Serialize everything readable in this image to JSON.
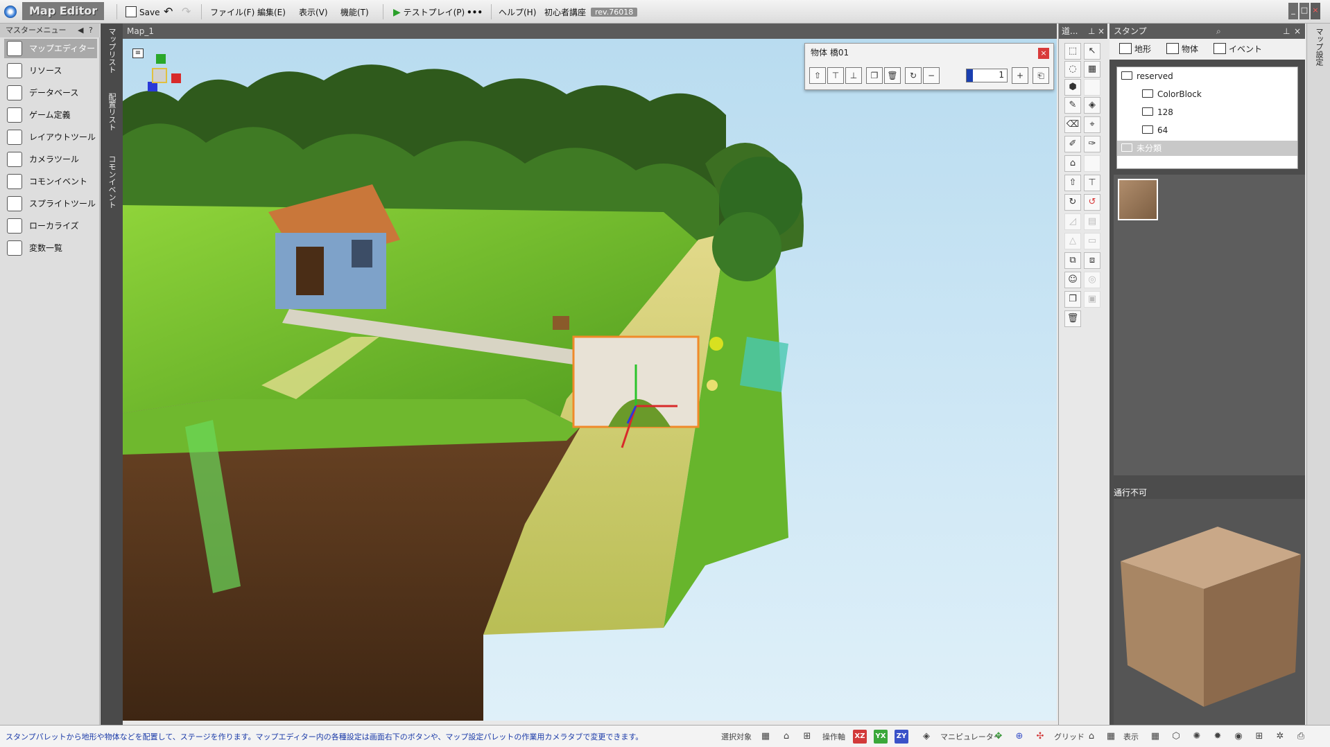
{
  "titlebar": {
    "app_title": "Map Editor",
    "save_label": "Save",
    "menus": [
      "ファイル(F)",
      "編集(E)",
      "表示(V)",
      "機能(T)"
    ],
    "testplay_label": "テストプレイ(P)",
    "more_label": "•••",
    "help_label": "ヘルプ(H)",
    "tutorial_label": "初心者講座",
    "revision": "rev.76018"
  },
  "left_menu": {
    "header": "マスターメニュー",
    "items": [
      {
        "label": "マップエディター",
        "icon": "map-editor-icon",
        "active": true
      },
      {
        "label": "リソース",
        "icon": "resource-icon"
      },
      {
        "label": "データベース",
        "icon": "database-icon"
      },
      {
        "label": "ゲーム定義",
        "icon": "game-definition-icon"
      },
      {
        "label": "レイアウトツール",
        "icon": "layout-tool-icon"
      },
      {
        "label": "カメラツール",
        "icon": "camera-tool-icon"
      },
      {
        "label": "コモンイベント",
        "icon": "common-event-icon"
      },
      {
        "label": "スプライトツール",
        "icon": "sprite-tool-icon"
      },
      {
        "label": "ローカライズ",
        "icon": "localize-icon"
      },
      {
        "label": "変数一覧",
        "icon": "variables-icon"
      }
    ]
  },
  "vertical_tabs": [
    "マップリスト",
    "配置リスト",
    "コモンイベント"
  ],
  "viewport": {
    "tab_title": "Map_1"
  },
  "object_panel": {
    "title": "物体 橋01",
    "close": "×",
    "value": "1",
    "level": 0.15
  },
  "tool_palette": {
    "header": "道..."
  },
  "stamp_panel": {
    "header": "スタンプ",
    "tabs": [
      "地形",
      "物体",
      "イベント"
    ],
    "tree": [
      {
        "label": "reserved",
        "level": 0
      },
      {
        "label": "ColorBlock",
        "level": 1
      },
      {
        "label": "128",
        "level": 1
      },
      {
        "label": "64",
        "level": 1
      },
      {
        "label": "未分類",
        "level": 0,
        "selected": true
      }
    ],
    "preview_label": "通行不可"
  },
  "right_strip_label": "マップ設定",
  "statusbar": {
    "message": "スタンプパレットから地形や物体などを配置して、ステージを作ります。マップエディター内の各種設定は画面右下のボタンや、マップ設定パレットの作業用カメラタブで変更できます。",
    "select_target_label": "選択対象",
    "operation_axis_label": "操作軸",
    "axis_buttons": [
      "XZ",
      "YX",
      "ZY"
    ],
    "manipulator_label": "マニピュレーター",
    "grid_label": "グリッド",
    "display_label": "表示"
  },
  "colors": {
    "axis_xz": "#d23a3a",
    "axis_yx": "#3aa83a",
    "axis_zy": "#3a52c8",
    "status_text": "#1a3aa8"
  }
}
